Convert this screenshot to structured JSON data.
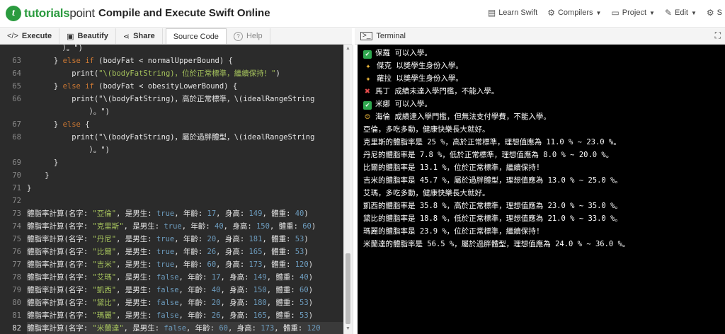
{
  "header": {
    "logo_brand": "tutorials",
    "logo_brand2": "point",
    "title": "Compile and Execute Swift Online",
    "menu": [
      {
        "label": "Learn Swift",
        "icon": "book-icon"
      },
      {
        "label": "Compilers",
        "icon": "gear-icon"
      },
      {
        "label": "Project",
        "icon": "folder-icon"
      },
      {
        "label": "Edit",
        "icon": "edit-icon"
      },
      {
        "label": "S",
        "icon": "settings-icon"
      }
    ]
  },
  "toolbar": {
    "execute": "Execute",
    "beautify": "Beautify",
    "share": "Share",
    "source_code": "Source Code",
    "help": "Help"
  },
  "editor": {
    "lines": [
      {
        "n": "",
        "text": "        ）。\")"
      },
      {
        "n": "63",
        "text": "      } else if (bodyFat < normalUpperBound) {"
      },
      {
        "n": "64",
        "text": "          print(\"\\(bodyFatString)，位於正常標準，繼續保持！\")"
      },
      {
        "n": "65",
        "text": "      } else if (bodyFat < obesityLowerBound) {"
      },
      {
        "n": "66",
        "text": "          print(\"\\(bodyFatString)，高於正常標準，\\(idealRangeString"
      },
      {
        "n": "",
        "text": "              ）。\")"
      },
      {
        "n": "67",
        "text": "      } else {"
      },
      {
        "n": "68",
        "text": "          print(\"\\(bodyFatString)，屬於過胖體型，\\(idealRangeString"
      },
      {
        "n": "",
        "text": "              ）。\")"
      },
      {
        "n": "69",
        "text": "      }"
      },
      {
        "n": "70",
        "text": "    }"
      },
      {
        "n": "71",
        "text": "}"
      },
      {
        "n": "72",
        "text": ""
      },
      {
        "n": "73",
        "text": "體脂率計算(名字: \"亞倫\", 是男生: true, 年齡: 17, 身高: 149, 體重: 40)"
      },
      {
        "n": "74",
        "text": "體脂率計算(名字: \"克里斯\", 是男生: true, 年齡: 40, 身高: 150, 體重: 60)"
      },
      {
        "n": "75",
        "text": "體脂率計算(名字: \"丹尼\", 是男生: true, 年齡: 20, 身高: 181, 體重: 53)"
      },
      {
        "n": "76",
        "text": "體脂率計算(名字: \"比爾\", 是男生: true, 年齡: 26, 身高: 165, 體重: 53)"
      },
      {
        "n": "77",
        "text": "體脂率計算(名字: \"吉米\", 是男生: true, 年齡: 60, 身高: 173, 體重: 120)"
      },
      {
        "n": "78",
        "text": "體脂率計算(名字: \"艾瑪\", 是男生: false, 年齡: 17, 身高: 149, 體重: 40)"
      },
      {
        "n": "79",
        "text": "體脂率計算(名字: \"凱西\", 是男生: false, 年齡: 40, 身高: 150, 體重: 60)"
      },
      {
        "n": "80",
        "text": "體脂率計算(名字: \"黛比\", 是男生: false, 年齡: 20, 身高: 180, 體重: 53)"
      },
      {
        "n": "81",
        "text": "體脂率計算(名字: \"瑪麗\", 是男生: false, 年齡: 26, 身高: 165, 體重: 53)"
      },
      {
        "n": "82",
        "text": "體脂率計算(名字: \"米蘭達\", 是男生: false, 年齡: 60, 身高: 173, 體重: 120"
      },
      {
        "n": "",
        "text": ")"
      }
    ],
    "active_line": "82"
  },
  "terminal": {
    "title": "Terminal",
    "lines": [
      {
        "badge": "check",
        "text": "保羅 可以入學。"
      },
      {
        "badge": "party",
        "text": "傑克 以獎學生身份入學。"
      },
      {
        "badge": "party",
        "text": "蘿拉 以獎學生身份入學。"
      },
      {
        "badge": "cross",
        "text": "馬丁 成績未達入學門檻，不能入學。"
      },
      {
        "badge": "check",
        "text": "米娜 可以入學。"
      },
      {
        "badge": "sad",
        "text": "海倫 成績達入學門檻，但無法支付學費，不能入學。"
      },
      {
        "badge": "",
        "text": "亞倫，多吃多動，健康快樂長大就好。"
      },
      {
        "badge": "",
        "text": "克里斯的體脂率是 25 %，高於正常標準，理想值應為 11.0 % ~ 23.0 %。"
      },
      {
        "badge": "",
        "text": "丹尼的體脂率是 7.8 %，低於正常標準，理想值應為 8.0 % ~ 20.0 %。"
      },
      {
        "badge": "",
        "text": "比爾的體脂率是 13.1 %，位於正常標準，繼續保持!"
      },
      {
        "badge": "",
        "text": "吉米的體脂率是 45.7 %，屬於過胖體型，理想值應為 13.0 % ~ 25.0 %。"
      },
      {
        "badge": "",
        "text": "艾瑪，多吃多動，健康快樂長大就好。"
      },
      {
        "badge": "",
        "text": "凱西的體脂率是 35.8 %，高於正常標準，理想值應為 23.0 % ~ 35.0 %。"
      },
      {
        "badge": "",
        "text": "黛比的體脂率是 18.8 %，低於正常標準，理想值應為 21.0 % ~ 33.0 %。"
      },
      {
        "badge": "",
        "text": "瑪麗的體脂率是 23.9 %，位於正常標準，繼續保持!"
      },
      {
        "badge": "",
        "text": "米蘭達的體脂率是 56.5 %，屬於過胖體型，理想值應為 24.0 % ~ 36.0 %。"
      }
    ]
  }
}
